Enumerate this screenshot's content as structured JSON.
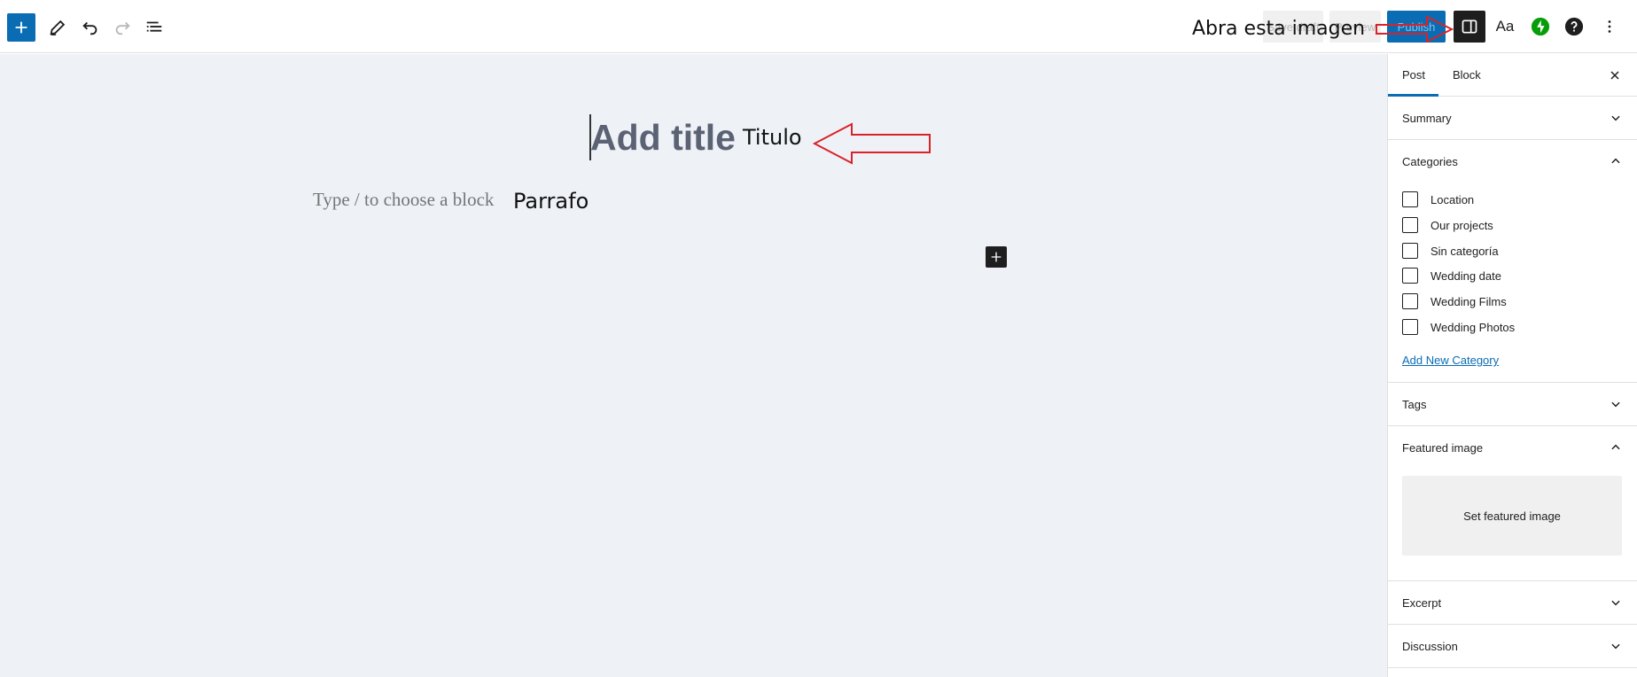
{
  "toolbar": {
    "icons": {
      "inserter": "plus-icon",
      "tools": "pencil-icon",
      "undo": "undo-icon",
      "redo": "redo-icon",
      "outline": "list-view-icon",
      "settings": "sidebar-toggle-icon",
      "styles": "Aa",
      "jetpack": "jetpack-icon",
      "help": "help-icon",
      "options": "more-vertical-icon"
    },
    "save_draft_label": "Save draft",
    "preview_label": "Preview",
    "publish_label": "Publish",
    "styles_label": "Aa",
    "accent_color": "#0a6db4"
  },
  "editor": {
    "title_placeholder": "Add title",
    "paragraph_placeholder": "Type / to choose a block"
  },
  "annotations": {
    "top_note": "Abra esta imagen",
    "title_note": "Titulo",
    "paragraph_note": "Parrafo",
    "arrow_color": "#d9222a"
  },
  "sidebar": {
    "tabs": [
      "Post",
      "Block"
    ],
    "active_tab": "Post",
    "panels": {
      "summary": "Summary",
      "categories": "Categories",
      "tags": "Tags",
      "featured_image": "Featured image",
      "excerpt": "Excerpt",
      "discussion": "Discussion"
    },
    "categories": [
      {
        "label": "Location",
        "checked": false
      },
      {
        "label": "Our projects",
        "checked": false
      },
      {
        "label": "Sin categoría",
        "checked": false
      },
      {
        "label": "Wedding date",
        "checked": false
      },
      {
        "label": "Wedding Films",
        "checked": false
      },
      {
        "label": "Wedding Photos",
        "checked": false
      }
    ],
    "add_new_category": "Add New Category",
    "set_featured_image": "Set featured image"
  }
}
